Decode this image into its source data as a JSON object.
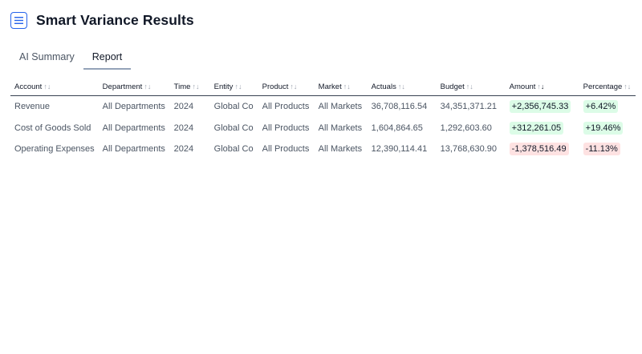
{
  "header": {
    "title": "Smart Variance Results"
  },
  "tabs": [
    {
      "label": "AI Summary",
      "active": false
    },
    {
      "label": "Report",
      "active": true
    }
  ],
  "table": {
    "columns": [
      "Account",
      "Department",
      "Time",
      "Entity",
      "Product",
      "Market",
      "Actuals",
      "Budget",
      "Amount",
      "Percentage"
    ],
    "sort_indicator": "↑↓",
    "sorted_column": "Amount",
    "sorted_direction": "descending",
    "rows": [
      [
        "Revenue",
        "All Departments",
        "2024",
        "Global Co",
        "All Products",
        "All Markets",
        "36,708,116.54",
        "34,351,371.21",
        "+2,356,745.33",
        "+6.42%"
      ],
      [
        "Cost of Goods Sold",
        "All Departments",
        "2024",
        "Global Co",
        "All Products",
        "All Markets",
        "1,604,864.65",
        "1,292,603.60",
        "+312,261.05",
        "+19.46%"
      ],
      [
        "Operating Expenses",
        "All Departments",
        "2024",
        "Global Co",
        "All Products",
        "All Markets",
        "12,390,114.41",
        "13,768,630.90",
        "-1,378,516.49",
        "-11.13%"
      ]
    ]
  },
  "colors": {
    "accent": "#2563eb",
    "positive_bg": "#dcfce7",
    "negative_bg": "#fee2e2"
  },
  "icons": {
    "menu": "hamburger-menu-icon",
    "sort": "sort-arrows-icon"
  }
}
